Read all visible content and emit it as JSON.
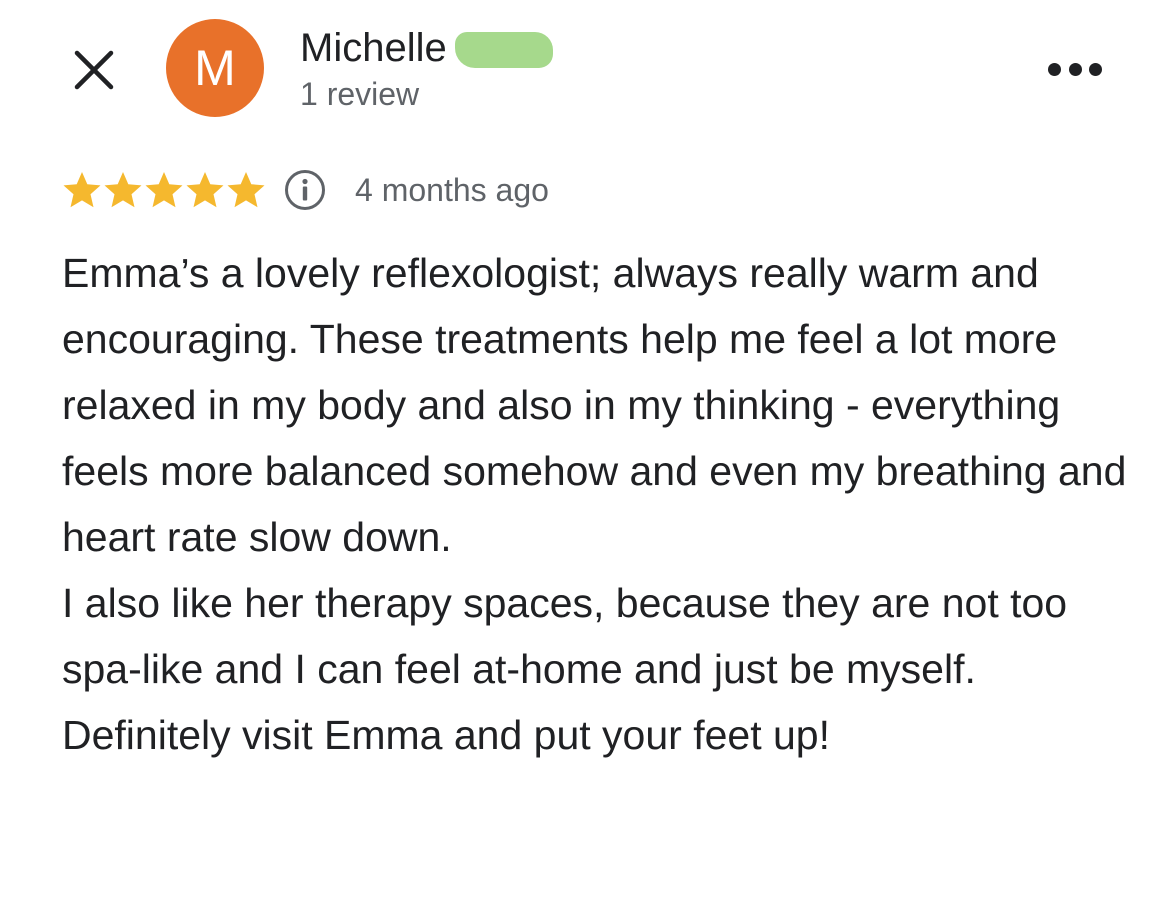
{
  "reviewer": {
    "initial": "M",
    "name": "Michelle",
    "review_count": "1 review",
    "avatar_color": "#e8712a"
  },
  "rating": {
    "stars": 5,
    "max_stars": 5,
    "star_color": "#f5b82e",
    "date": "4 months ago"
  },
  "review": {
    "paragraph_1": "Emma’s a lovely reflexologist; always really warm and encouraging. These treatments help me feel a lot more relaxed in my body and also in my thinking - everything feels more balanced somehow and even my breathing and heart rate slow down.",
    "paragraph_2": "I also like her therapy spaces, because they are not too spa-like and I can feel at-home and just be myself. Definitely visit Emma and put your feet up!"
  },
  "icons": {
    "close": "close-icon",
    "more": "more-options-icon",
    "info": "info-icon",
    "star": "star-icon"
  }
}
